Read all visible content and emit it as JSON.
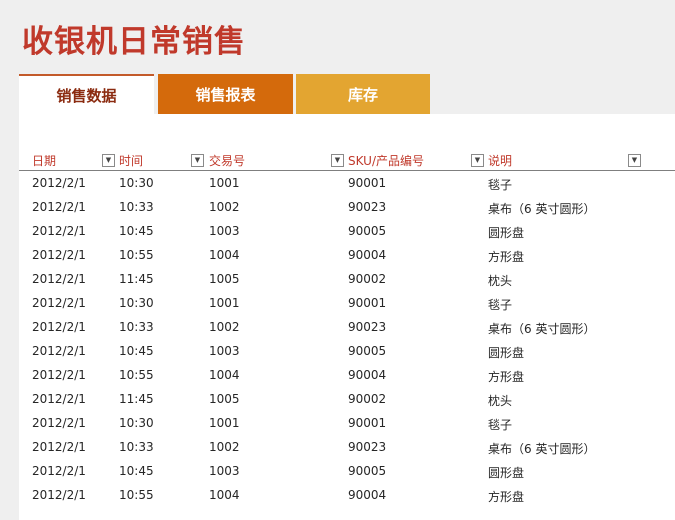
{
  "title": "收银机日常销售",
  "tabs": [
    {
      "label": "销售数据"
    },
    {
      "label": "销售报表"
    },
    {
      "label": "库存"
    }
  ],
  "columns": [
    {
      "label": "日期"
    },
    {
      "label": "时间"
    },
    {
      "label": "交易号"
    },
    {
      "label": "SKU/产品编号"
    },
    {
      "label": "说明"
    }
  ],
  "filter_icon": "dropdown-arrow",
  "rows": [
    {
      "date": "2012/2/1",
      "time": "10:30",
      "tx": "1001",
      "sku": "90001",
      "desc": "毯子"
    },
    {
      "date": "2012/2/1",
      "time": "10:33",
      "tx": "1002",
      "sku": "90023",
      "desc": "桌布（6 英寸圆形）"
    },
    {
      "date": "2012/2/1",
      "time": "10:45",
      "tx": "1003",
      "sku": "90005",
      "desc": "圆形盘"
    },
    {
      "date": "2012/2/1",
      "time": "10:55",
      "tx": "1004",
      "sku": "90004",
      "desc": "方形盘"
    },
    {
      "date": "2012/2/1",
      "time": "11:45",
      "tx": "1005",
      "sku": "90002",
      "desc": "枕头"
    },
    {
      "date": "2012/2/1",
      "time": "10:30",
      "tx": "1001",
      "sku": "90001",
      "desc": "毯子"
    },
    {
      "date": "2012/2/1",
      "time": "10:33",
      "tx": "1002",
      "sku": "90023",
      "desc": "桌布（6 英寸圆形）"
    },
    {
      "date": "2012/2/1",
      "time": "10:45",
      "tx": "1003",
      "sku": "90005",
      "desc": "圆形盘"
    },
    {
      "date": "2012/2/1",
      "time": "10:55",
      "tx": "1004",
      "sku": "90004",
      "desc": "方形盘"
    },
    {
      "date": "2012/2/1",
      "time": "11:45",
      "tx": "1005",
      "sku": "90002",
      "desc": "枕头"
    },
    {
      "date": "2012/2/1",
      "time": "10:30",
      "tx": "1001",
      "sku": "90001",
      "desc": "毯子"
    },
    {
      "date": "2012/2/1",
      "time": "10:33",
      "tx": "1002",
      "sku": "90023",
      "desc": "桌布（6 英寸圆形）"
    },
    {
      "date": "2012/2/1",
      "time": "10:45",
      "tx": "1003",
      "sku": "90005",
      "desc": "圆形盘"
    },
    {
      "date": "2012/2/1",
      "time": "10:55",
      "tx": "1004",
      "sku": "90004",
      "desc": "方形盘"
    }
  ]
}
